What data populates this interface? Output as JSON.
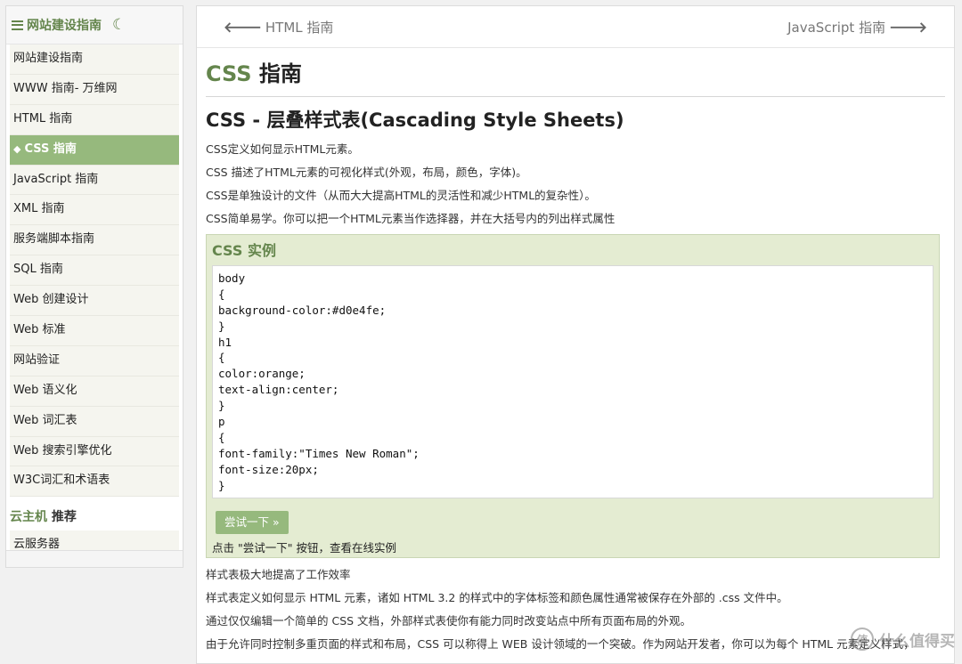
{
  "sidebar": {
    "title": "网站建设指南",
    "items": [
      {
        "label": "网站建设指南",
        "active": false
      },
      {
        "label": "WWW 指南- 万维网",
        "active": false
      },
      {
        "label": "HTML 指南",
        "active": false
      },
      {
        "label": "CSS 指南",
        "active": true
      },
      {
        "label": "JavaScript 指南",
        "active": false
      },
      {
        "label": "XML 指南",
        "active": false
      },
      {
        "label": "服务端脚本指南",
        "active": false
      },
      {
        "label": "SQL 指南",
        "active": false
      },
      {
        "label": "Web 创建设计",
        "active": false
      },
      {
        "label": "Web 标准",
        "active": false
      },
      {
        "label": "网站验证",
        "active": false
      },
      {
        "label": "Web 语义化",
        "active": false
      },
      {
        "label": "Web 词汇表",
        "active": false
      },
      {
        "label": "Web 搜索引擎优化",
        "active": false
      },
      {
        "label": "W3C词汇和术语表",
        "active": false
      }
    ],
    "section_green": "云主机",
    "section_rest": " 推荐",
    "section_items": [
      {
        "label": "云服务器"
      }
    ]
  },
  "navbar": {
    "prev": "HTML 指南",
    "next": "JavaScript 指南"
  },
  "page": {
    "title_green": "CSS",
    "title_rest": " 指南",
    "subtitle": "CSS - 层叠样式表(Cascading Style Sheets)",
    "intro": [
      "CSS定义如何显示HTML元素。",
      "CSS 描述了HTML元素的可视化样式(外观，布局，颜色，字体)。",
      "CSS是单独设计的文件（从而大大提高HTML的灵活性和减少HTML的复杂性）。",
      "CSS简单易学。你可以把一个HTML元素当作选择器，并在大括号内的列出样式属性"
    ],
    "example": {
      "title": "CSS 实例",
      "code": [
        "body",
        "{",
        "background-color:#d0e4fe;",
        "}",
        "h1",
        "{",
        "color:orange;",
        "text-align:center;",
        "}",
        "p",
        "{",
        "font-family:\"Times New Roman\";",
        "font-size:20px;",
        "}"
      ],
      "button": "尝试一下 »",
      "note": "点击 \"尝试一下\" 按钮，查看在线实例"
    },
    "after": [
      "样式表极大地提高了工作效率",
      "样式表定义如何显示 HTML 元素，诸如 HTML 3.2 的样式中的字体标签和颜色属性通常被保存在外部的 .css 文件中。",
      "通过仅仅编辑一个简单的 CSS 文档，外部样式表使你有能力同时改变站点中所有页面布局的外观。",
      "由于允许同时控制多重页面的样式和布局，CSS 可以称得上 WEB 设计领域的一个突破。作为网站开发者，你可以为每个 HTML 元素定义样式，"
    ]
  },
  "watermark": {
    "glyph": "值",
    "text": "什么值得买"
  },
  "colors": {
    "accent": "#64854c",
    "active_bg": "#96b97d",
    "example_bg": "#e4ecd2"
  }
}
